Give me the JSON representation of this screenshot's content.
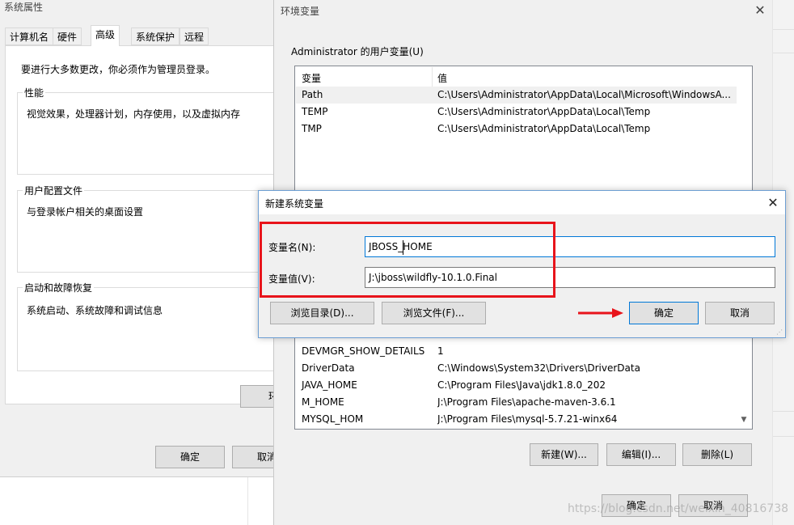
{
  "sys_props": {
    "title": "系统属性",
    "tabs": [
      "计算机名",
      "硬件",
      "高级",
      "系统保护",
      "远程"
    ],
    "admin_notice": "要进行大多数更改，你必须作为管理员登录。",
    "perf_title": "性能",
    "perf_desc": "视觉效果，处理器计划，内存使用，以及虚拟内存",
    "profile_title": "用户配置文件",
    "profile_desc": "与登录帐户相关的桌面设置",
    "startup_title": "启动和故障恢复",
    "startup_desc": "系统启动、系统故障和调试信息",
    "env_btn_partial": "环",
    "ok": "确定",
    "cancel": "取消"
  },
  "env": {
    "title": "环境变量",
    "user_group_title": "Administrator 的用户变量(U)",
    "col_var": "变量",
    "col_val": "值",
    "user_vars": [
      {
        "name": "Path",
        "value": "C:\\Users\\Administrator\\AppData\\Local\\Microsoft\\WindowsA..."
      },
      {
        "name": "TEMP",
        "value": "C:\\Users\\Administrator\\AppData\\Local\\Temp"
      },
      {
        "name": "TMP",
        "value": "C:\\Users\\Administrator\\AppData\\Local\\Temp"
      }
    ],
    "sys_vars": [
      {
        "name": "DEVMGR_SHOW_DETAILS",
        "value": "1"
      },
      {
        "name": "DriverData",
        "value": "C:\\Windows\\System32\\Drivers\\DriverData"
      },
      {
        "name": "JAVA_HOME",
        "value": "C:\\Program Files\\Java\\jdk1.8.0_202"
      },
      {
        "name": "M_HOME",
        "value": "J:\\Program Files\\apache-maven-3.6.1"
      },
      {
        "name": "MYSQL_HOM",
        "value": "J:\\Program Files\\mysql-5.7.21-winx64"
      }
    ],
    "new_btn": "新建(W)...",
    "edit_btn": "编辑(I)...",
    "delete_btn": "删除(L)",
    "ok": "确定",
    "cancel": "取消"
  },
  "newvar": {
    "title": "新建系统变量",
    "name_label": "变量名(N):",
    "value_label": "变量值(V):",
    "name_value": "JBOSS_HOME",
    "value_value": "J:\\jboss\\wildfly-10.1.0.Final",
    "browse_dir": "浏览目录(D)...",
    "browse_file": "浏览文件(F)...",
    "ok": "确定",
    "cancel": "取消"
  },
  "watermark": "https://blog.csdn.net/weixin_40816738",
  "colors": {
    "highlight_box": "#e8141b",
    "arrow": "#e8141b",
    "dialog_border": "#6d9fd3",
    "dialog_bg": "#f0f0f0"
  }
}
